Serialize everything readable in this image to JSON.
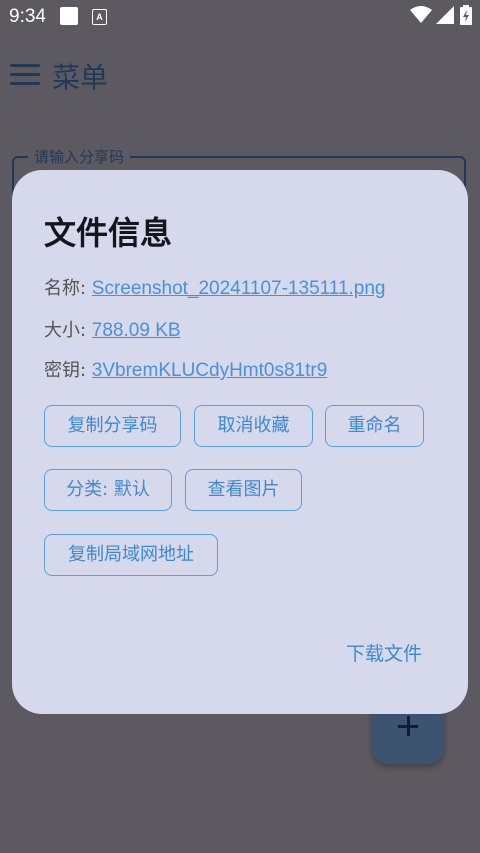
{
  "status_bar": {
    "time": "9:34",
    "icons": [
      "square-icon",
      "a-icon",
      "wifi-icon",
      "signal-icon",
      "battery-icon"
    ]
  },
  "app_bar": {
    "title": "菜单"
  },
  "share_input": {
    "label": "请输入分享码"
  },
  "dialog": {
    "title": "文件信息",
    "name_label": "名称: ",
    "name_value": "Screenshot_20241107-135111.png",
    "size_label": "大小: ",
    "size_value": "788.09 KB",
    "key_label": "密钥: ",
    "key_value": "3VbremKLUCdyHmt0s81tr9",
    "buttons": {
      "copy_share_code": "复制分享码",
      "unfavorite": "取消收藏",
      "rename": "重命名",
      "category": "分类: 默认",
      "view_image": "查看图片",
      "copy_lan_address": "复制局域网地址"
    },
    "download": "下载文件"
  },
  "colors": {
    "scrim_background": "#5c5a60",
    "dialog_background": "#d5d9eb",
    "accent": "#4a90d9",
    "app_bar_text": "#1e3a58",
    "fab": "#3d5470"
  }
}
